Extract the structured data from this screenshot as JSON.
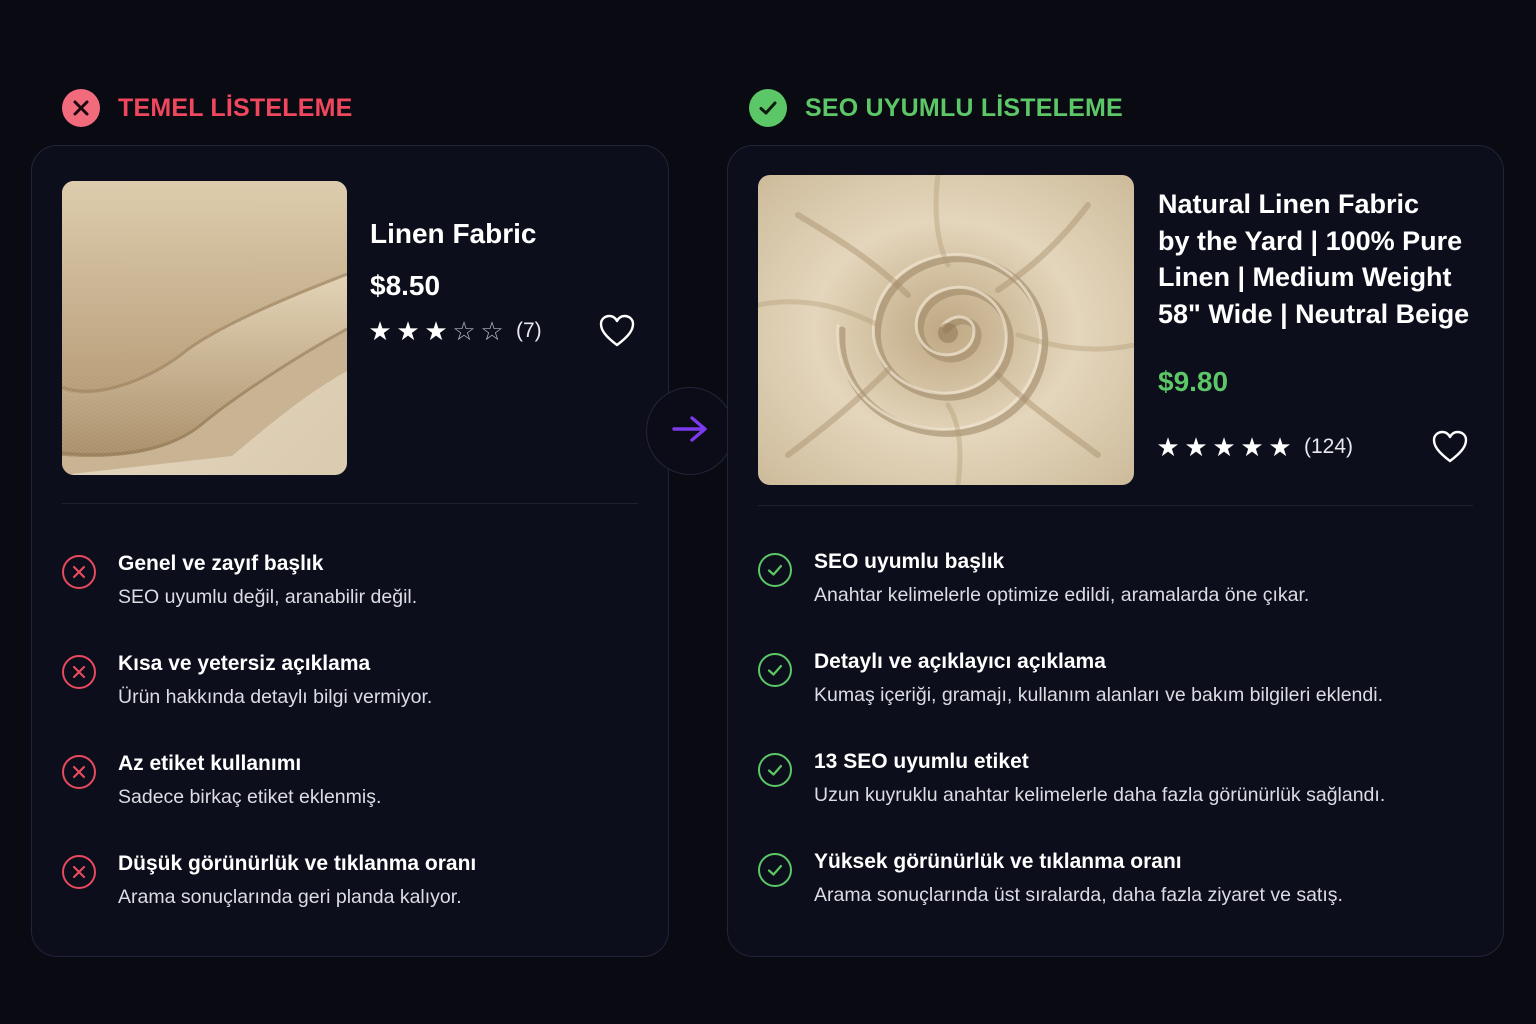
{
  "left": {
    "header": "TEMEL LİSTELEME",
    "product": {
      "title": "Linen Fabric",
      "price": "$8.50",
      "rating": 3,
      "max_rating": 5,
      "reviews": "(7)"
    },
    "features": [
      {
        "title": "Genel ve zayıf başlık",
        "desc": "SEO uyumlu değil, aranabilir değil."
      },
      {
        "title": "Kısa ve yetersiz açıklama",
        "desc": "Ürün hakkında detaylı bilgi vermiyor."
      },
      {
        "title": "Az etiket kullanımı",
        "desc": "Sadece birkaç etiket eklenmiş."
      },
      {
        "title": "Düşük görünürlük ve tıklanma oranı",
        "desc": "Arama sonuçlarında geri planda kalıyor."
      }
    ]
  },
  "right": {
    "header": "SEO UYUMLU LİSTELEME",
    "product": {
      "title_lines": [
        "Natural Linen Fabric",
        "by the Yard | 100% Pure",
        "Linen | Medium Weight",
        "58\" Wide | Neutral Beige"
      ],
      "price": "$9.80",
      "rating": 5,
      "max_rating": 5,
      "reviews": "(124)"
    },
    "features": [
      {
        "title": "SEO uyumlu başlık",
        "desc": "Anahtar kelimelerle optimize edildi, aramalarda öne çıkar."
      },
      {
        "title": "Detaylı ve açıklayıcı açıklama",
        "desc": "Kumaş içeriği, gramajı, kullanım alanları ve bakım bilgileri eklendi."
      },
      {
        "title": "13 SEO uyumlu etiket",
        "desc": "Uzun kuyruklu anahtar kelimelerle daha fazla görünürlük sağlandı."
      },
      {
        "title": "Yüksek görünürlük ve tıklanma oranı",
        "desc": "Arama sonuçlarında üst sıralarda, daha fazla ziyaret ve satış."
      }
    ]
  },
  "icons": {
    "bad": "x-circle-icon",
    "good": "check-circle-icon",
    "arrow": "arrow-right-icon",
    "heart": "heart-icon",
    "star": "star-icon"
  },
  "colors": {
    "background": "#0a0a13",
    "bad": "#f0475f",
    "good": "#5cc766",
    "accent_arrow": "#7c3aed"
  }
}
